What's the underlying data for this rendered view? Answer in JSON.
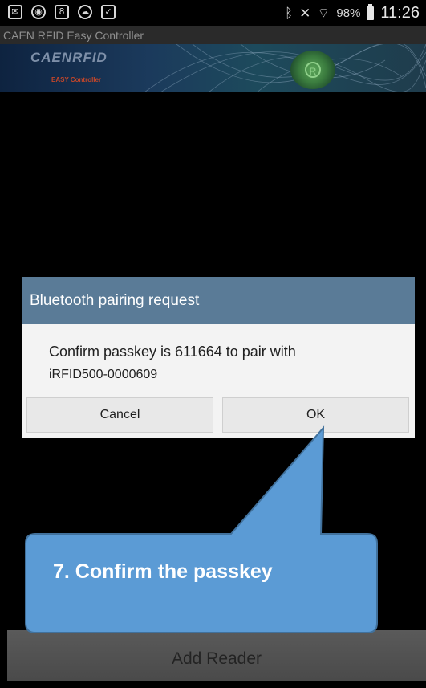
{
  "status_bar": {
    "notification_icons": [
      "mail-icon",
      "app-icon",
      "app-icon",
      "cloud-icon",
      "clipboard-icon"
    ],
    "right_icons": [
      "bluetooth-icon",
      "mute-icon",
      "wifi-icon"
    ],
    "battery": "98%",
    "time": "11:26"
  },
  "app": {
    "title": "CAEN RFID Easy Controller",
    "banner_brand": "CAENRFID",
    "banner_subtitle": "EASY Controller"
  },
  "dialog": {
    "title": "Bluetooth pairing request",
    "message": "Confirm passkey is 611664 to pair with",
    "device": "iRFID500-0000609",
    "cancel_label": "Cancel",
    "ok_label": "OK"
  },
  "callout": {
    "text": "7. Confirm the passkey",
    "fill": "#5b9bd5",
    "border": "#41719c"
  },
  "bottom": {
    "add_reader_label": "Add Reader"
  }
}
